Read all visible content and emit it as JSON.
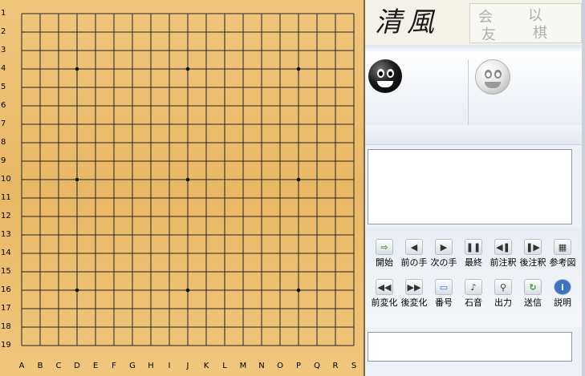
{
  "window": {
    "title": "清風"
  },
  "logo": {
    "chars": [
      "会",
      "以",
      "友",
      "棋"
    ]
  },
  "board": {
    "rows": [
      "1",
      "2",
      "3",
      "4",
      "5",
      "6",
      "7",
      "8",
      "9",
      "10",
      "11",
      "12",
      "13",
      "14",
      "15",
      "16",
      "17",
      "18",
      "19"
    ],
    "cols": [
      "A",
      "B",
      "C",
      "D",
      "E",
      "F",
      "G",
      "H",
      "I",
      "J",
      "K",
      "L",
      "M",
      "N",
      "O",
      "P",
      "Q",
      "R",
      "S"
    ],
    "star_points": [
      [
        "D",
        "4"
      ],
      [
        "J",
        "4"
      ],
      [
        "P",
        "4"
      ],
      [
        "D",
        "10"
      ],
      [
        "J",
        "10"
      ],
      [
        "P",
        "10"
      ],
      [
        "D",
        "16"
      ],
      [
        "J",
        "16"
      ],
      [
        "P",
        "16"
      ]
    ]
  },
  "players": {
    "black": {
      "icon": "black-stone-face-icon"
    },
    "white": {
      "icon": "white-stone-face-icon"
    }
  },
  "controls": {
    "row1": [
      {
        "label": "開始",
        "icon": "start-icon",
        "glyph": "⇨"
      },
      {
        "label": "前の手",
        "icon": "previous-move-icon",
        "glyph": "◀"
      },
      {
        "label": "次の手",
        "icon": "next-move-icon",
        "glyph": "▶"
      },
      {
        "label": "最終",
        "icon": "pause-icon",
        "glyph": "❚❚"
      },
      {
        "label": "前注釈",
        "icon": "previous-comment-icon",
        "glyph": "◀❚"
      },
      {
        "label": "後注釈",
        "icon": "next-comment-icon",
        "glyph": "❚▶"
      },
      {
        "label": "参考図",
        "icon": "reference-diagram-icon",
        "glyph": "▦"
      }
    ],
    "row2": [
      {
        "label": "前変化",
        "icon": "previous-variation-icon",
        "glyph": "◀◀"
      },
      {
        "label": "後変化",
        "icon": "next-variation-icon",
        "glyph": "▶▶"
      },
      {
        "label": "番号",
        "icon": "number-display-icon",
        "glyph": "▭"
      },
      {
        "label": "石音",
        "icon": "stone-sound-icon",
        "glyph": "♪"
      },
      {
        "label": "出力",
        "icon": "magnifier-icon",
        "glyph": "⚲"
      },
      {
        "label": "送信",
        "icon": "send-icon",
        "glyph": "↻"
      },
      {
        "label": "説明",
        "icon": "info-icon",
        "glyph": "i"
      }
    ]
  },
  "colors": {
    "board": "#e9b865",
    "panel": "#eef1f6",
    "accent_green": "#3c9a2e",
    "accent_blue": "#3b73c5"
  }
}
